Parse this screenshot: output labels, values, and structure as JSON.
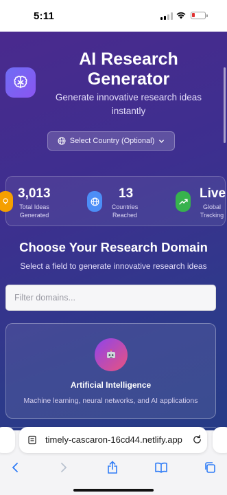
{
  "status_bar": {
    "time": "5:11"
  },
  "hero": {
    "title": "AI Research Generator",
    "subtitle": "Generate innovative research ideas instantly",
    "country_select": "Select Country (Optional)"
  },
  "stats": [
    {
      "value": "3,013",
      "label": "Total Ideas Generated",
      "icon": "lightbulb-icon",
      "color": "#f59f00"
    },
    {
      "value": "13",
      "label": "Countries Reached",
      "icon": "globe-icon",
      "color": "#4c8ef7"
    },
    {
      "value": "Live",
      "label": "Global Tracking",
      "icon": "trending-up-icon",
      "color": "#37b24d"
    }
  ],
  "domains": {
    "heading": "Choose Your Research Domain",
    "subheading": "Select a field to generate innovative research ideas",
    "filter_placeholder": "Filter domains...",
    "cards": [
      {
        "name": "Artificial Intelligence",
        "description": "Machine learning, neural networks, and AI applications",
        "icon": "robot-icon"
      }
    ]
  },
  "browser": {
    "url": "timely-cascaron-16cd44.netlify.app"
  },
  "colors": {
    "accent": "#7b6cf6",
    "background_start": "#4a2a8e",
    "background_end": "#263b86"
  }
}
